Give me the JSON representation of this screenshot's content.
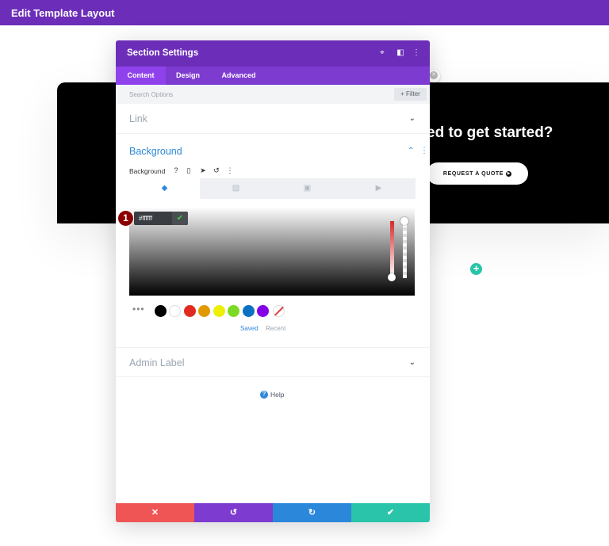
{
  "topbar": {
    "title": "Edit Template Layout"
  },
  "cta": {
    "heading": "ed to get started?",
    "button_label": "REQUEST A QUOTE",
    "add_icon": "plus-icon"
  },
  "modal": {
    "title": "Section Settings",
    "header_icons": [
      "focus-icon",
      "split-view-icon",
      "more-vertical-icon"
    ],
    "tabs": [
      {
        "label": "Content",
        "active": true
      },
      {
        "label": "Design",
        "active": false
      },
      {
        "label": "Advanced",
        "active": false
      }
    ],
    "search": {
      "placeholder": "Search Options",
      "filter_label": "+ Filter"
    },
    "link": {
      "label": "Link"
    },
    "background": {
      "label": "Background",
      "field_label": "Background",
      "type_tabs": [
        "paint-bucket-icon",
        "gradient-icon",
        "image-icon",
        "video-icon"
      ],
      "hex_value": "#ffffff",
      "step_badge": "1",
      "swatches": [
        "#000000",
        "#ffffff",
        "#e02b20",
        "#e09900",
        "#edf000",
        "#7cda24",
        "#0c71c3",
        "#8300e9"
      ],
      "palette_tabs": {
        "saved": "Saved",
        "recent": "Recent"
      }
    },
    "admin_label": {
      "label": "Admin Label"
    },
    "help": {
      "label": "Help"
    },
    "footer_colors": {
      "cancel": "#ef5555",
      "undo": "#7e3bd0",
      "redo": "#2b87da",
      "save": "#29c4a9"
    }
  }
}
